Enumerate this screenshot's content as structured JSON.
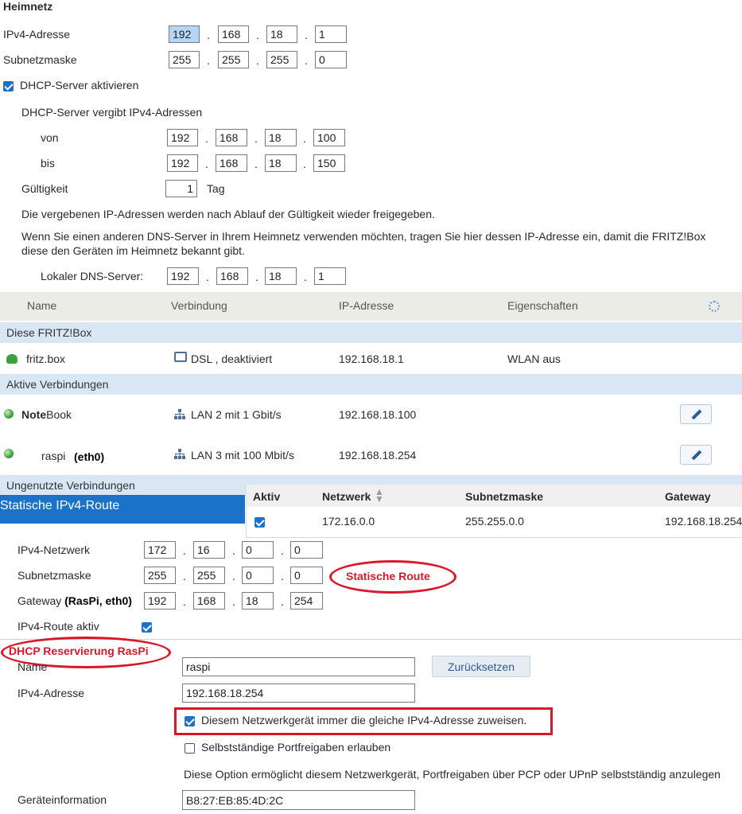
{
  "heimnetz": {
    "title": "Heimnetz",
    "ipv4_label": "IPv4-Adresse",
    "ipv4": [
      "192",
      "168",
      "18",
      "1"
    ],
    "subnet_label": "Subnetzmaske",
    "subnet": [
      "255",
      "255",
      "255",
      "0"
    ],
    "dhcp_enable_label": "DHCP-Server aktivieren",
    "dhcp_range_label": "DHCP-Server vergibt IPv4-Adressen",
    "von_label": "von",
    "von": [
      "192",
      "168",
      "18",
      "100"
    ],
    "bis_label": "bis",
    "bis": [
      "192",
      "168",
      "18",
      "150"
    ],
    "validity_label": "Gültigkeit",
    "validity_value": "1",
    "validity_unit": "Tag",
    "info1": "Die vergebenen IP-Adressen werden nach Ablauf der Gültigkeit wieder freigegeben.",
    "info2a": "Wenn Sie einen anderen DNS-Server in Ihrem Heimnetz verwenden möchten, tragen Sie hier dessen IP-Adresse ein, damit die FRITZ!Box",
    "info2b": "diese den Geräten im Heimnetz bekannt gibt.",
    "dns_label": "Lokaler DNS-Server:",
    "dns": [
      "192",
      "168",
      "18",
      "1"
    ]
  },
  "devices": {
    "headers": [
      "Name",
      "Verbindung",
      "IP-Adresse",
      "Eigenschaften"
    ],
    "section_fritzbox": "Diese FRITZ!Box",
    "fritzbox": {
      "name": "fritz.box",
      "connection": "DSL , deaktiviert",
      "ip": "192.168.18.1",
      "props": "WLAN aus"
    },
    "section_active": "Aktive Verbindungen",
    "notebook": {
      "name_bold": "Note",
      "name_rest": "Book",
      "connection": "LAN 2 mit 1 Gbit/s",
      "ip": "192.168.18.100"
    },
    "raspi": {
      "name": "raspi",
      "annotation": "(eth0)",
      "connection": "LAN 3 mit 100 Mbit/s",
      "ip": "192.168.18.254"
    },
    "section_unused": "Ungenutzte Verbindungen"
  },
  "routes_table": {
    "headers": [
      "Aktiv",
      "Netzwerk",
      "Subnetzmaske",
      "Gateway"
    ],
    "row": {
      "network": "172.16.0.0",
      "subnet": "255.255.0.0",
      "gateway": "192.168.18.254"
    }
  },
  "static_route": {
    "title": "Statische IPv4-Route",
    "network_label": "IPv4-Netzwerk",
    "network": [
      "172",
      "16",
      "0",
      "0"
    ],
    "subnet_label": "Subnetzmaske",
    "subnet": [
      "255",
      "255",
      "0",
      "0"
    ],
    "gateway_label": "Gateway",
    "gateway_note": "(RasPi, eth0)",
    "gateway": [
      "192",
      "168",
      "18",
      "254"
    ],
    "active_label": "IPv4-Route aktiv",
    "annotation": "Statische Route"
  },
  "dhcp_reservation": {
    "annotation": "DHCP Reservierung RasPi",
    "name_label": "Name",
    "name_value": "raspi",
    "reset_button": "Zurücksetzen",
    "ipv4_label": "IPv4-Adresse",
    "ipv4_value": "192.168.18.254",
    "always_same_label": "Diesem Netzwerkgerät immer die gleiche IPv4-Adresse zuweisen.",
    "portfwd_label": "Selbstständige Portfreigaben erlauben",
    "option_info": "Diese Option ermöglicht diesem Netzwerkgerät, Portfreigaben über PCP oder UPnP selbstständig anzulegen",
    "device_info_label": "Geräteinformation",
    "device_info_value": "B8:27:EB:85:4D:2C"
  },
  "colors": {
    "accent": "#1a73c8",
    "annotation_red": "#d8182a",
    "section_bar": "#d9e7f4"
  }
}
